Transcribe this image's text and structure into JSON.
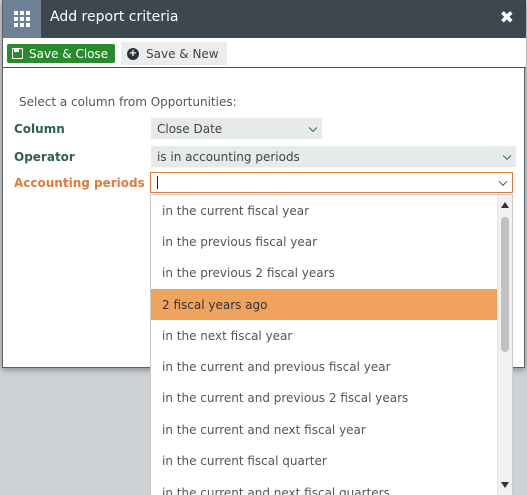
{
  "dialog": {
    "title": "Add report criteria",
    "close_glyph": "✖",
    "title_icon": "grid-icon",
    "close_icon": "close-icon"
  },
  "toolbar": {
    "save_close_label": "Save & Close",
    "save_close_icon": "floppy-disk-icon",
    "save_new_label": "Save & New",
    "save_new_icon": "plus-circle-icon"
  },
  "form": {
    "intro": "Select a column from Opportunities:",
    "column_label": "Column",
    "column_value": "Close Date",
    "operator_label": "Operator",
    "operator_value": "is in accounting periods",
    "periods_label": "Accounting periods",
    "periods_value": ""
  },
  "dropdown": {
    "options": [
      "in the current fiscal year",
      "in the previous fiscal year",
      "in the previous 2 fiscal years",
      "2 fiscal years ago",
      "in the next fiscal year",
      "in the current and previous fiscal year",
      "in the current and previous 2 fiscal years",
      "in the current and next fiscal year",
      "in the current fiscal quarter",
      "in the current and next fiscal quarters"
    ],
    "highlighted": "2 fiscal years ago"
  },
  "colors": {
    "titlebar": "#3e4650",
    "icon_box": "#6f8196",
    "save_button": "#2b8a2e",
    "label_green": "#2f5f4f",
    "active_label": "#e07a3f",
    "highlight": "#f0a35c"
  }
}
